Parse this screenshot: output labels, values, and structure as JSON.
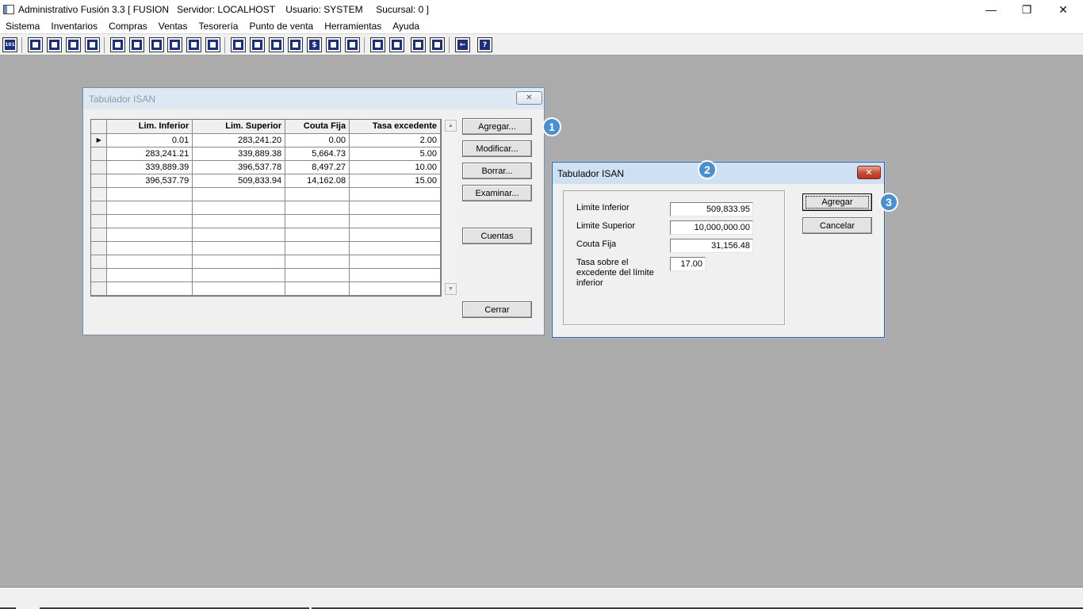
{
  "window": {
    "title": "Administrativo Fusión 3.3 [ FUSION   Servidor: LOCALHOST    Usuario: SYSTEM     Sucursal: 0 ]",
    "minimize": "—",
    "restore": "❐",
    "close": "✕"
  },
  "menu": [
    "Sistema",
    "Inventarios",
    "Compras",
    "Ventas",
    "Tesorería",
    "Punto de venta",
    "Herramientas",
    "Ayuda"
  ],
  "toolbar": {
    "first_label": "101",
    "icons": [
      "report-icon",
      "copy-icon",
      "clipboard-icon",
      "swap-icon",
      "zoom-icon",
      "user-icon",
      "folder-icon",
      "print-preview-icon",
      "print-icon",
      "document-icon",
      "list-icon",
      "users-icon",
      "folder-open-icon",
      "export-icon",
      "add-icon",
      "dollar-icon",
      "page-icon",
      "table-icon",
      "home-icon",
      "search-icon",
      "refresh-icon",
      "undo-icon",
      "back-arrow-icon",
      "help-icon"
    ],
    "glyphs": {
      "dollar": "$",
      "help": "?",
      "back": "←"
    }
  },
  "tabulador": {
    "title": "Tabulador ISAN",
    "close_glyph": "✕",
    "columns": [
      "Lim. Inferior",
      "Lim. Superior",
      "Couta Fija",
      "Tasa excedente"
    ],
    "row_indicator": "▶",
    "rows": [
      [
        "0.01",
        "283,241.20",
        "0.00",
        "2.00"
      ],
      [
        "283,241.21",
        "339,889.38",
        "5,664.73",
        "5.00"
      ],
      [
        "339,889.39",
        "396,537.78",
        "8,497.27",
        "10.00"
      ],
      [
        "396,537.79",
        "509,833.94",
        "14,162.08",
        "15.00"
      ]
    ],
    "empty_rows": 8,
    "scroll_up": "▲",
    "scroll_down": "▼",
    "buttons": {
      "agregar": "Agregar...",
      "modificar": "Modificar...",
      "borrar": "Borrar...",
      "examinar": "Examinar...",
      "cuentas": "Cuentas",
      "cerrar": "Cerrar"
    }
  },
  "dialog": {
    "title": "Tabulador ISAN",
    "close_glyph": "✕",
    "fields": {
      "limite_inferior": {
        "label": "Limite Inferior",
        "value": "509,833.95"
      },
      "limite_superior": {
        "label": "Limite Superior",
        "value": "10,000,000.00"
      },
      "couta_fija": {
        "label": "Couta Fija",
        "value": "31,156.48"
      },
      "tasa": {
        "label": "Tasa sobre el excedente del límite inferior",
        "value": "17.00"
      }
    },
    "buttons": {
      "agregar": "Agregar",
      "cancelar": "Cancelar"
    }
  },
  "callouts": [
    "1",
    "2",
    "3"
  ]
}
